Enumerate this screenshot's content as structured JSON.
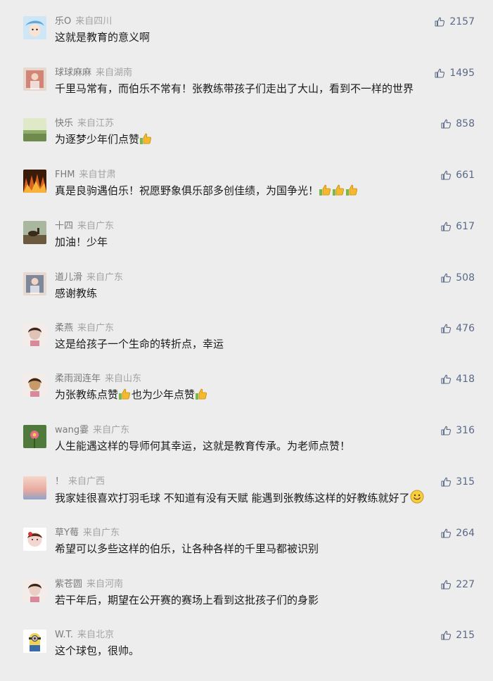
{
  "comments": [
    {
      "nickname": "乐O",
      "location": "来自四川",
      "text": "这就是教育的意义啊",
      "likes": "2157",
      "avatar_color": "#5fa8dc",
      "avatar": "cartoon-avatar",
      "suffix_emoji": ""
    },
    {
      "nickname": "球球麻麻",
      "location": "来自湖南",
      "text": "千里马常有，而伯乐不常有！张教练带孩子们走出了大山，看到不一样的世界",
      "likes": "1495",
      "avatar_color": "#c86a5a",
      "avatar": "photo-avatar",
      "suffix_emoji": ""
    },
    {
      "nickname": "快乐",
      "location": "来自江苏",
      "text": "为逐梦少年们点赞",
      "likes": "858",
      "avatar_color": "#8fae6a",
      "avatar": "landscape-avatar",
      "suffix_emoji": "thumbs-up"
    },
    {
      "nickname": "FHM",
      "location": "来自甘肃",
      "text": "真是良驹遇伯乐！祝愿野象俱乐部多创佳绩，为国争光！",
      "likes": "661",
      "avatar_color": "#d9641e",
      "avatar": "fire-avatar",
      "suffix_emoji": "thumbs-up-x3"
    },
    {
      "nickname": "十四",
      "location": "来自广东",
      "text": "加油！少年",
      "likes": "617",
      "avatar_color": "#6b5a40",
      "avatar": "horse-avatar",
      "suffix_emoji": ""
    },
    {
      "nickname": "道儿滑",
      "location": "来自广东",
      "text": "感谢教练",
      "likes": "508",
      "avatar_color": "#5b6e8a",
      "avatar": "photo-avatar",
      "suffix_emoji": ""
    },
    {
      "nickname": "柔燕",
      "location": "来自广东",
      "text": "这是给孩子一个生命的转折点，幸运",
      "likes": "476",
      "avatar_color": "#e0c2b6",
      "avatar": "portrait-avatar",
      "suffix_emoji": ""
    },
    {
      "nickname": "柔雨润连年",
      "location": "来自山东",
      "text": "为张教练点赞",
      "text2": "也为少年点赞",
      "likes": "418",
      "avatar_color": "#c79a6a",
      "avatar": "portrait-avatar",
      "suffix_emoji": "thumbs-up"
    },
    {
      "nickname": "wang霎",
      "location": "来自广东",
      "text": "人生能遇这样的导师何其幸运，这就是教育传承。为老师点赞！",
      "likes": "316",
      "avatar_color": "#4f7a3c",
      "avatar": "flower-avatar",
      "suffix_emoji": ""
    },
    {
      "nickname": "！",
      "location": "来自广西",
      "text": "我家娃很喜欢打羽毛球 不知道有没有天赋 能遇到张教练这样的好教练就好了",
      "likes": "315",
      "avatar_color": "#e8a9a0",
      "avatar": "sunset-avatar",
      "suffix_emoji": "smile"
    },
    {
      "nickname": "草Y莓",
      "location": "来自广东",
      "text": "希望可以多些这样的伯乐，让各种各样的千里马都被识别",
      "likes": "264",
      "avatar_color": "#f4d6d0",
      "avatar": "cartoon-girl-avatar",
      "suffix_emoji": ""
    },
    {
      "nickname": "紫苍圆",
      "location": "来自河南",
      "text": "若干年后，期望在公开赛的赛场上看到这批孩子们的身影",
      "likes": "227",
      "avatar_color": "#e9cfc4",
      "avatar": "portrait-avatar",
      "suffix_emoji": ""
    },
    {
      "nickname": "W.T.",
      "location": "来自北京",
      "text": "这个球包，很帅。",
      "likes": "215",
      "avatar_color": "#f0d25a",
      "avatar": "minion-avatar",
      "suffix_emoji": ""
    }
  ],
  "colors": {
    "background": "#ededed",
    "nickname": "#7a7a7a",
    "location": "#a3a3a3",
    "text": "#1b1b1b",
    "like": "#5a6a88"
  }
}
